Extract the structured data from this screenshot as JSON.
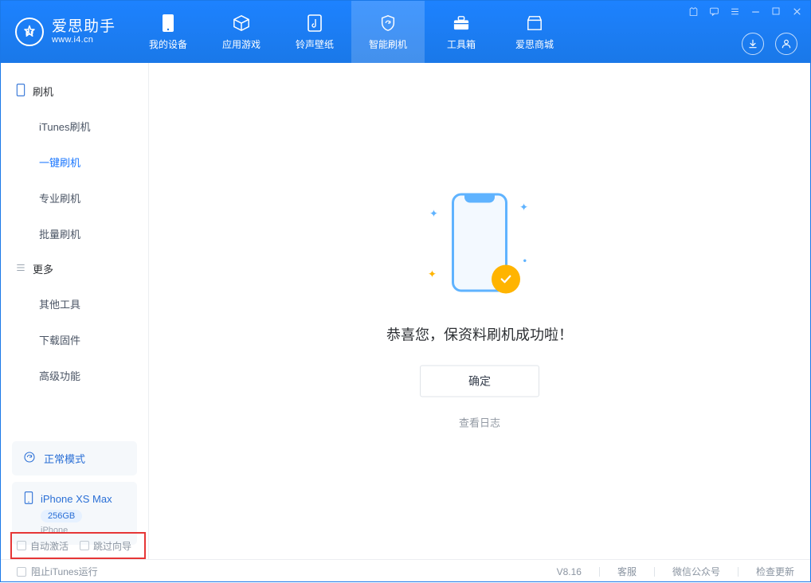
{
  "app": {
    "title": "爱思助手",
    "subtitle": "www.i4.cn"
  },
  "nav": {
    "items": [
      {
        "label": "我的设备"
      },
      {
        "label": "应用游戏"
      },
      {
        "label": "铃声壁纸"
      },
      {
        "label": "智能刷机"
      },
      {
        "label": "工具箱"
      },
      {
        "label": "爱思商城"
      }
    ]
  },
  "sidebar": {
    "section1": {
      "title": "刷机"
    },
    "items1": [
      {
        "label": "iTunes刷机"
      },
      {
        "label": "一键刷机"
      },
      {
        "label": "专业刷机"
      },
      {
        "label": "批量刷机"
      }
    ],
    "section2": {
      "title": "更多"
    },
    "items2": [
      {
        "label": "其他工具"
      },
      {
        "label": "下载固件"
      },
      {
        "label": "高级功能"
      }
    ],
    "mode_label": "正常模式",
    "device": {
      "name": "iPhone XS Max",
      "storage": "256GB",
      "type": "iPhone"
    },
    "highlight": {
      "opt1": "自动激活",
      "opt2": "跳过向导"
    }
  },
  "main": {
    "success_text": "恭喜您，保资料刷机成功啦！",
    "ok_button": "确定",
    "view_log": "查看日志"
  },
  "footer": {
    "block_itunes": "阻止iTunes运行",
    "version": "V8.16",
    "links": [
      {
        "label": "客服"
      },
      {
        "label": "微信公众号"
      },
      {
        "label": "检查更新"
      }
    ]
  }
}
